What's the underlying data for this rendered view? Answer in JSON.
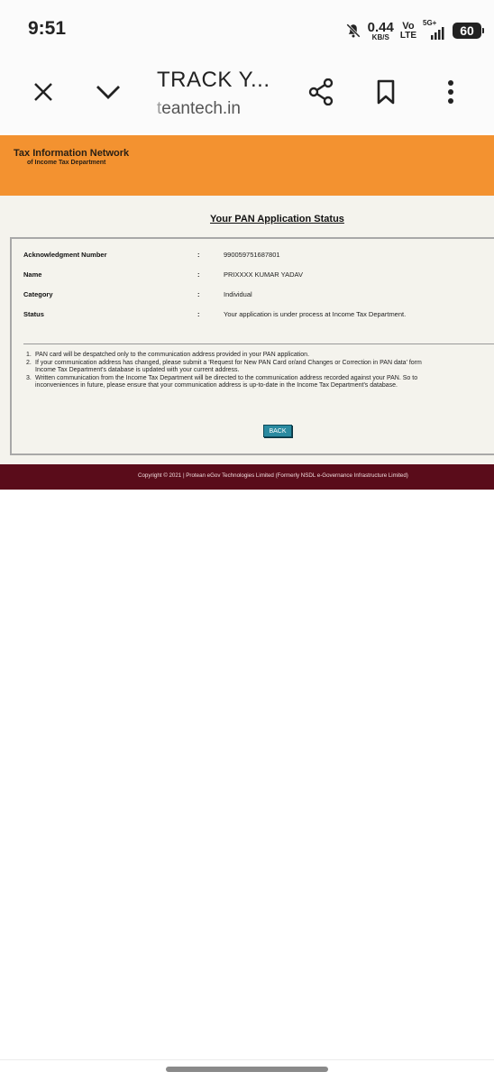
{
  "status_bar": {
    "time": "9:51",
    "speed_value": "0.44",
    "speed_unit": "KB/S",
    "volte_top": "Vo",
    "volte_bottom": "LTE",
    "network": "5G+",
    "battery": "60"
  },
  "browser": {
    "title": "TRACK Y...",
    "url_dim": "t",
    "url_main": "eantech.in",
    "icons": [
      "close-icon",
      "chevron-down-icon",
      "share-icon",
      "bookmark-icon",
      "more-vert-icon"
    ]
  },
  "site": {
    "banner_title": "Tax Information Network",
    "banner_subtitle": "of Income Tax Department",
    "heading": "Your PAN Application Status",
    "rows": [
      {
        "label": "Acknowledgment Number",
        "colon": ":",
        "value": "990059751687801"
      },
      {
        "label": "Name",
        "colon": ":",
        "value": "PRIXXXX KUMAR YADAV"
      },
      {
        "label": "Category",
        "colon": ":",
        "value": "Individual"
      },
      {
        "label": "Status",
        "colon": ":",
        "value": "Your application is under process at Income Tax Department."
      }
    ],
    "notes": [
      {
        "num": "1.",
        "lines": [
          "PAN card will be despatched only to the communication address provided in your PAN application."
        ]
      },
      {
        "num": "2.",
        "lines": [
          "If your communication address has changed, please submit a 'Request for New PAN Card or/and Changes or Correction in PAN data' form",
          "Income Tax Department's database is updated with your current address."
        ]
      },
      {
        "num": "3.",
        "lines": [
          "Written communication from the Income Tax Department will be directed to the communication address recorded against your PAN. So to",
          "inconveniences in future, please ensure that your communication address is up-to-date in the Income Tax Department's database."
        ]
      }
    ],
    "back_label": "BACK",
    "footer": "Copyright © 2021 | Protean eGov Technologies Limited (Formerly NSDL e-Governance Infrastructure Limited)"
  },
  "colors": {
    "banner": "#f39230",
    "footer": "#5a0c1a",
    "page_bg": "#f4f3ed",
    "back_button": "#2a8aa0"
  }
}
